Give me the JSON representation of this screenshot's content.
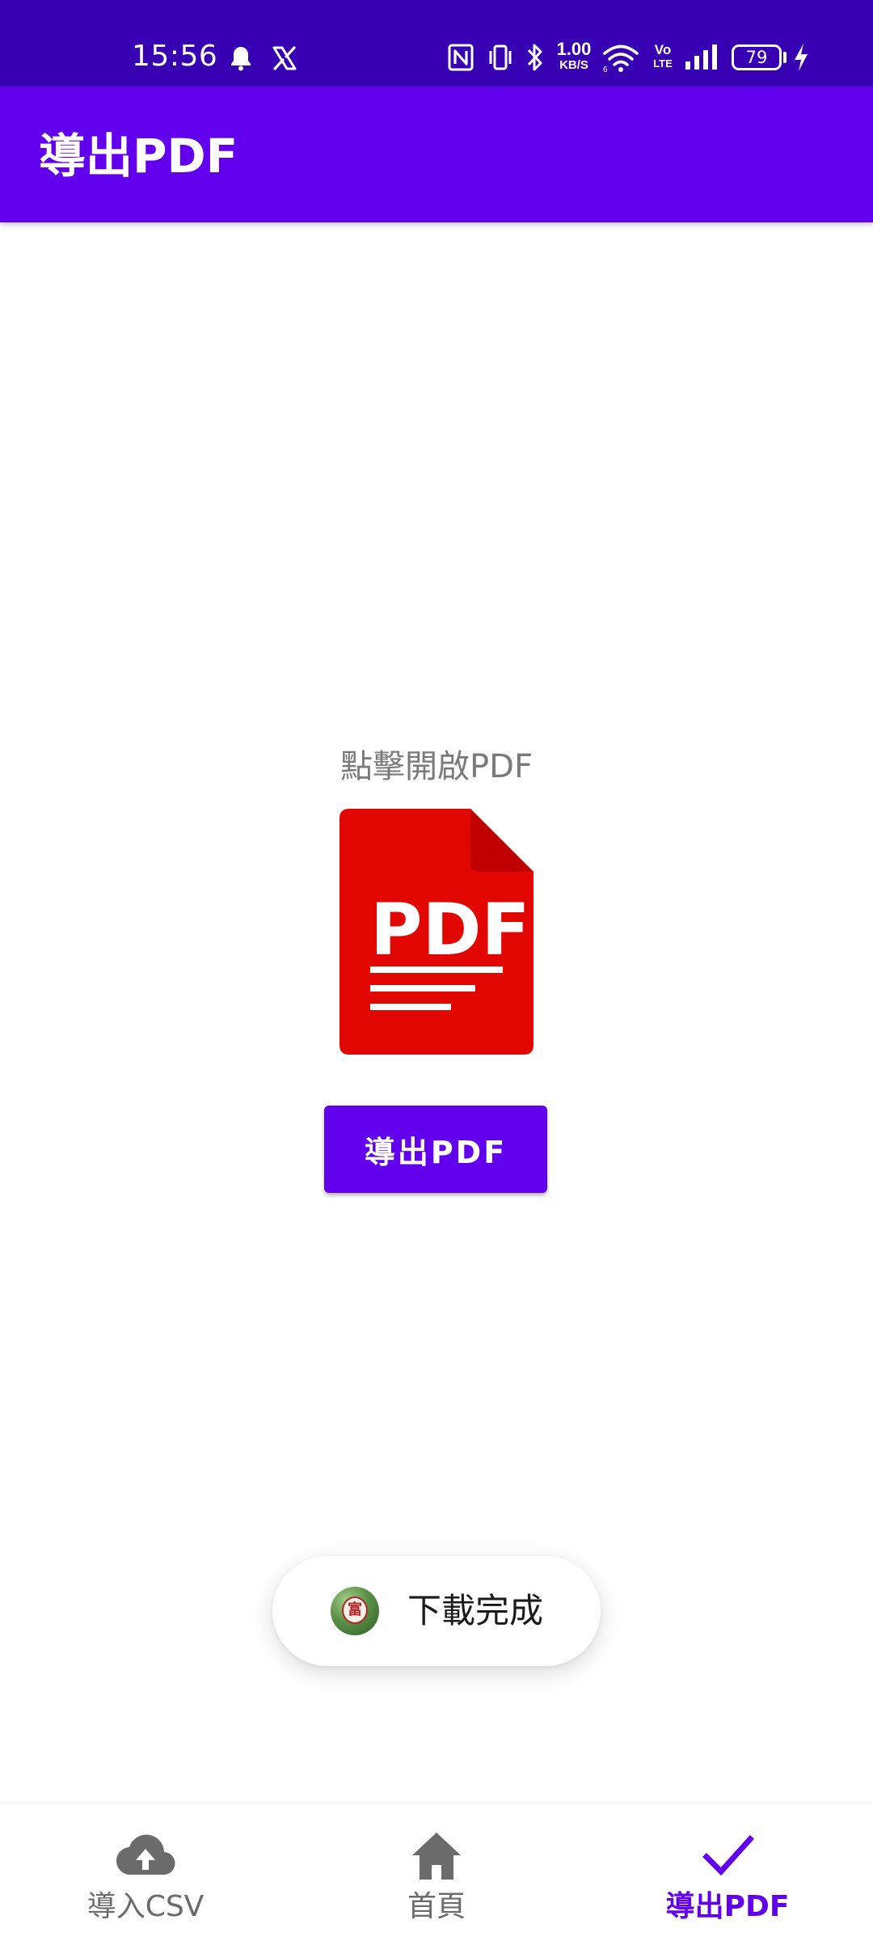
{
  "status_bar": {
    "time": "15:56",
    "battery_level": "79",
    "icons": [
      "bell-icon",
      "x-app-icon",
      "nfc-icon",
      "vibrate-icon",
      "bluetooth-icon",
      "data-speed-icon",
      "wifi-icon",
      "volte-icon",
      "signal-icon",
      "battery-icon",
      "charging-icon"
    ],
    "data_speed_value": "1.00",
    "data_speed_unit": "KB/S",
    "volte_top": "Vo",
    "volte_bottom": "LTE"
  },
  "app_bar": {
    "title": "導出PDF",
    "color": "#6200ee"
  },
  "main": {
    "open_hint": "點擊開啟PDF",
    "pdf_icon_label": "PDF",
    "export_button_label": "導出PDF"
  },
  "toast": {
    "message": "下載完成",
    "avatar_glyph": "富"
  },
  "bottom_nav": {
    "items": [
      {
        "label": "導入CSV",
        "icon": "cloud-upload-icon",
        "active": false
      },
      {
        "label": "首頁",
        "icon": "home-icon",
        "active": false
      },
      {
        "label": "導出PDF",
        "icon": "check-icon",
        "active": true
      }
    ],
    "active_color": "#6200ee",
    "inactive_color": "#6b6b6b"
  }
}
